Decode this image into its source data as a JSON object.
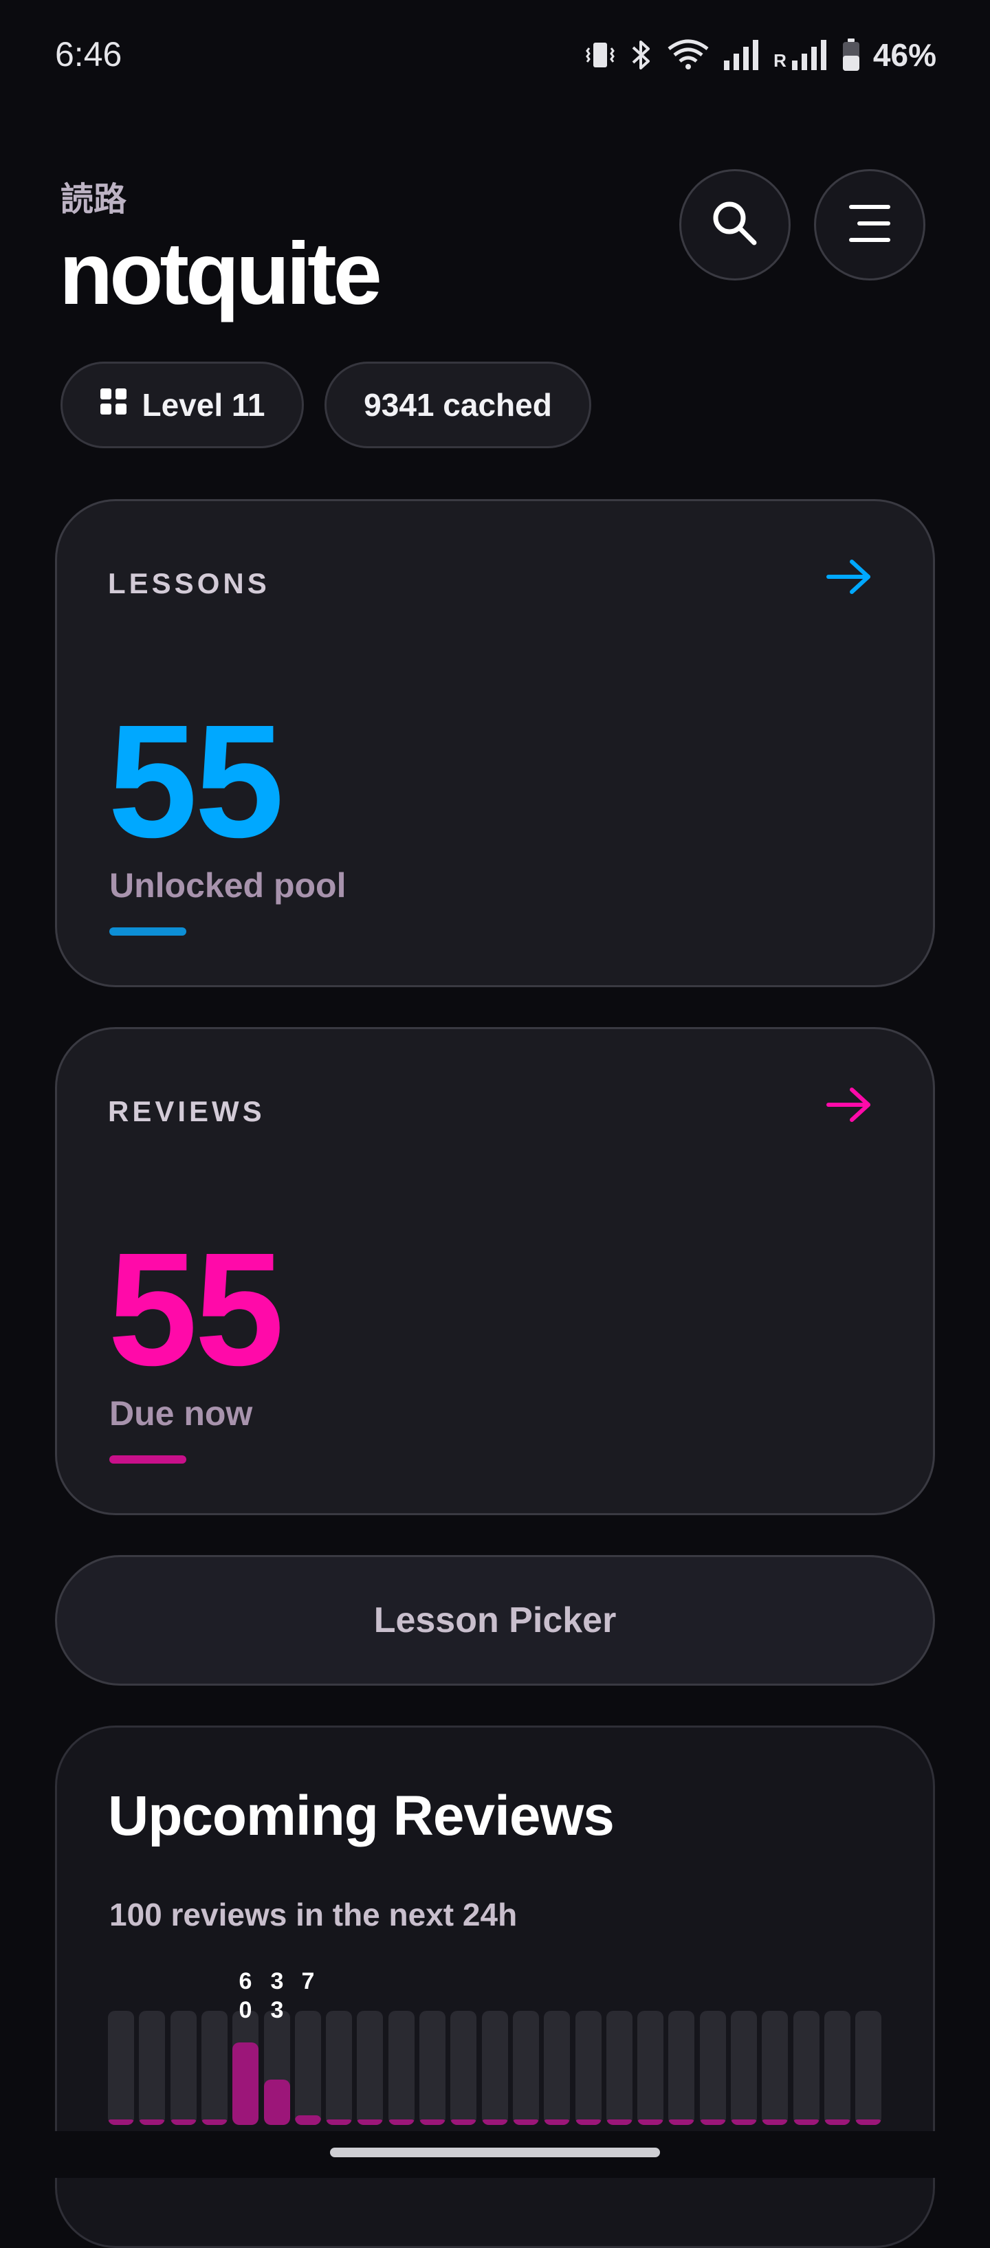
{
  "status_bar": {
    "time": "6:46",
    "battery": "46%",
    "roaming": "R",
    "icons": [
      "vibrate-icon",
      "bluetooth-icon",
      "wifi-icon",
      "signal-icon",
      "signal-roaming-icon",
      "battery-icon"
    ]
  },
  "header": {
    "subtitle": "読路",
    "title": "notquite"
  },
  "chips": {
    "level": "Level 11",
    "cached": "9341 cached"
  },
  "lessons": {
    "label": "LESSONS",
    "count": "55",
    "caption": "Unlocked pool",
    "accent": "#00a8ff"
  },
  "reviews": {
    "label": "REVIEWS",
    "count": "55",
    "caption": "Due now",
    "accent": "#ff0aa9"
  },
  "picker": {
    "label": "Lesson Picker"
  },
  "upcoming": {
    "title": "Upcoming Reviews",
    "subtitle": "100 reviews in the next 24h",
    "bar_max": 60,
    "hours": [
      {
        "count": 0,
        "label": ""
      },
      {
        "count": 0,
        "label": ""
      },
      {
        "count": 0,
        "label": ""
      },
      {
        "count": 0,
        "label": ""
      },
      {
        "count": 60,
        "label": "60"
      },
      {
        "count": 33,
        "label": "33"
      },
      {
        "count": 7,
        "label": "7"
      },
      {
        "count": 0,
        "label": ""
      },
      {
        "count": 0,
        "label": ""
      },
      {
        "count": 0,
        "label": ""
      },
      {
        "count": 0,
        "label": ""
      },
      {
        "count": 0,
        "label": ""
      },
      {
        "count": 0,
        "label": ""
      },
      {
        "count": 0,
        "label": ""
      },
      {
        "count": 0,
        "label": ""
      },
      {
        "count": 0,
        "label": ""
      },
      {
        "count": 0,
        "label": ""
      },
      {
        "count": 0,
        "label": ""
      },
      {
        "count": 0,
        "label": ""
      },
      {
        "count": 0,
        "label": ""
      },
      {
        "count": 0,
        "label": ""
      },
      {
        "count": 0,
        "label": ""
      },
      {
        "count": 0,
        "label": ""
      },
      {
        "count": 0,
        "label": ""
      },
      {
        "count": 0,
        "label": ""
      }
    ]
  }
}
